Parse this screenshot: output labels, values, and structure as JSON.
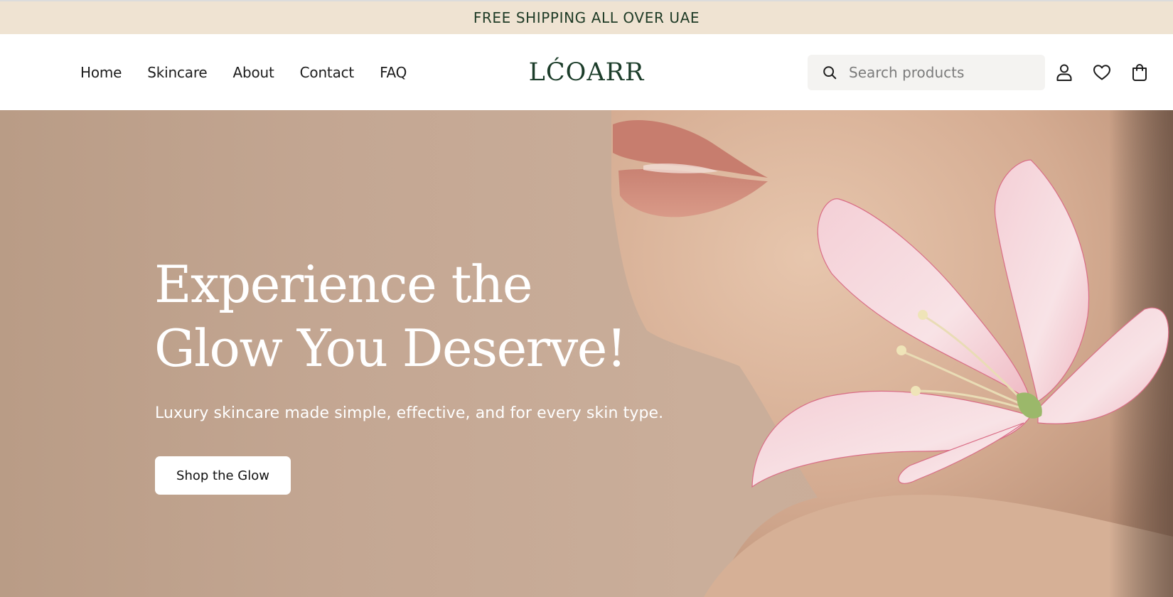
{
  "announcement": {
    "text": "FREE SHIPPING ALL OVER UAE"
  },
  "header": {
    "nav": [
      {
        "label": "Home"
      },
      {
        "label": "Skincare"
      },
      {
        "label": "About"
      },
      {
        "label": "Contact"
      },
      {
        "label": "FAQ"
      }
    ],
    "logo": "LĆOARR",
    "search": {
      "placeholder": "Search products",
      "value": ""
    },
    "icons": [
      "search-icon",
      "account-icon",
      "wishlist-heart-icon",
      "cart-bag-icon"
    ]
  },
  "hero": {
    "title_line1": "Experience the",
    "title_line2": "Glow You Deserve!",
    "subtitle": "Luxury skincare made simple, effective, and for every skin type.",
    "cta_label": "Shop the Glow",
    "image": "woman-face-with-pink-lily-flower"
  },
  "colors": {
    "announcement_bg": "#efe3d2",
    "brand_green": "#1c3d2a",
    "hero_bg": "#c4a793",
    "button_bg": "#ffffff"
  }
}
